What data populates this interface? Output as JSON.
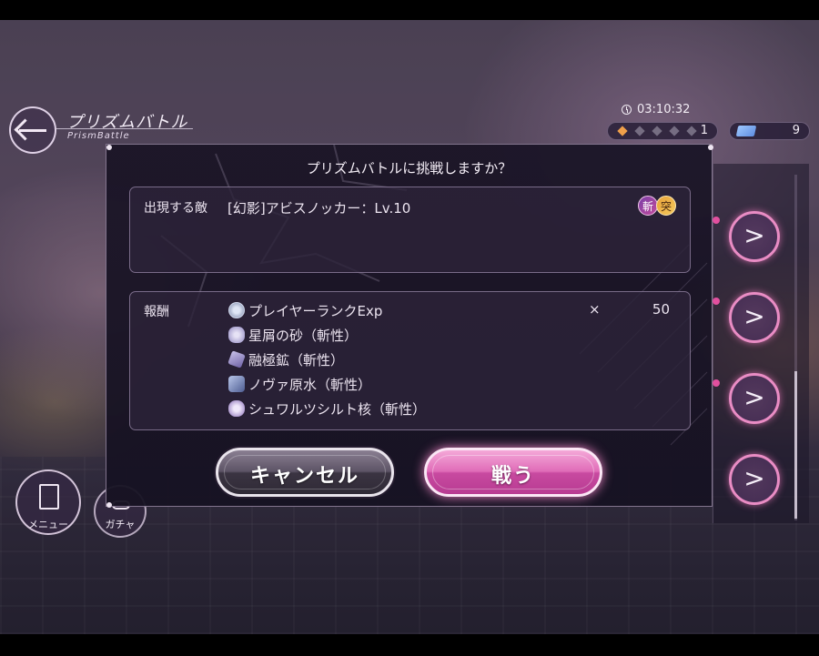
{
  "header": {
    "title": "プリズムバトル",
    "subtitle": "PrismBattle",
    "timer": "03:10:32",
    "rank_value": "1",
    "ticket_count": "9"
  },
  "dialog": {
    "title": "プリズムバトルに挑戦しますか？",
    "enemy_label": "出現する敵",
    "enemy_name": "[幻影]アビスノッカー：Lv.10",
    "badges": [
      "斬",
      "突"
    ],
    "reward_label": "報酬",
    "rewards": [
      {
        "icon": "exp-orb-icon",
        "name": "プレイヤーランクExp",
        "times": "×",
        "qty": "50"
      },
      {
        "icon": "stardust-icon",
        "name": "星屑の砂（斬性）"
      },
      {
        "icon": "ore-icon",
        "name": "融極鉱（斬性）"
      },
      {
        "icon": "nova-water-icon",
        "name": "ノヴァ原水（斬性）"
      },
      {
        "icon": "core-icon",
        "name": "シュワルツシルト核（斬性）"
      }
    ],
    "cancel_label": "キャンセル",
    "fight_label": "戦う"
  },
  "side_buttons": {
    "go_symbol": ">"
  },
  "bottom_nav": {
    "menu_label": "メニュー",
    "gacha_label": "ガチャ"
  },
  "colors": {
    "accent_pink": "#e06cb8",
    "dialog_bg": "#1a1426",
    "rank_diamond": "#f0a04a"
  }
}
